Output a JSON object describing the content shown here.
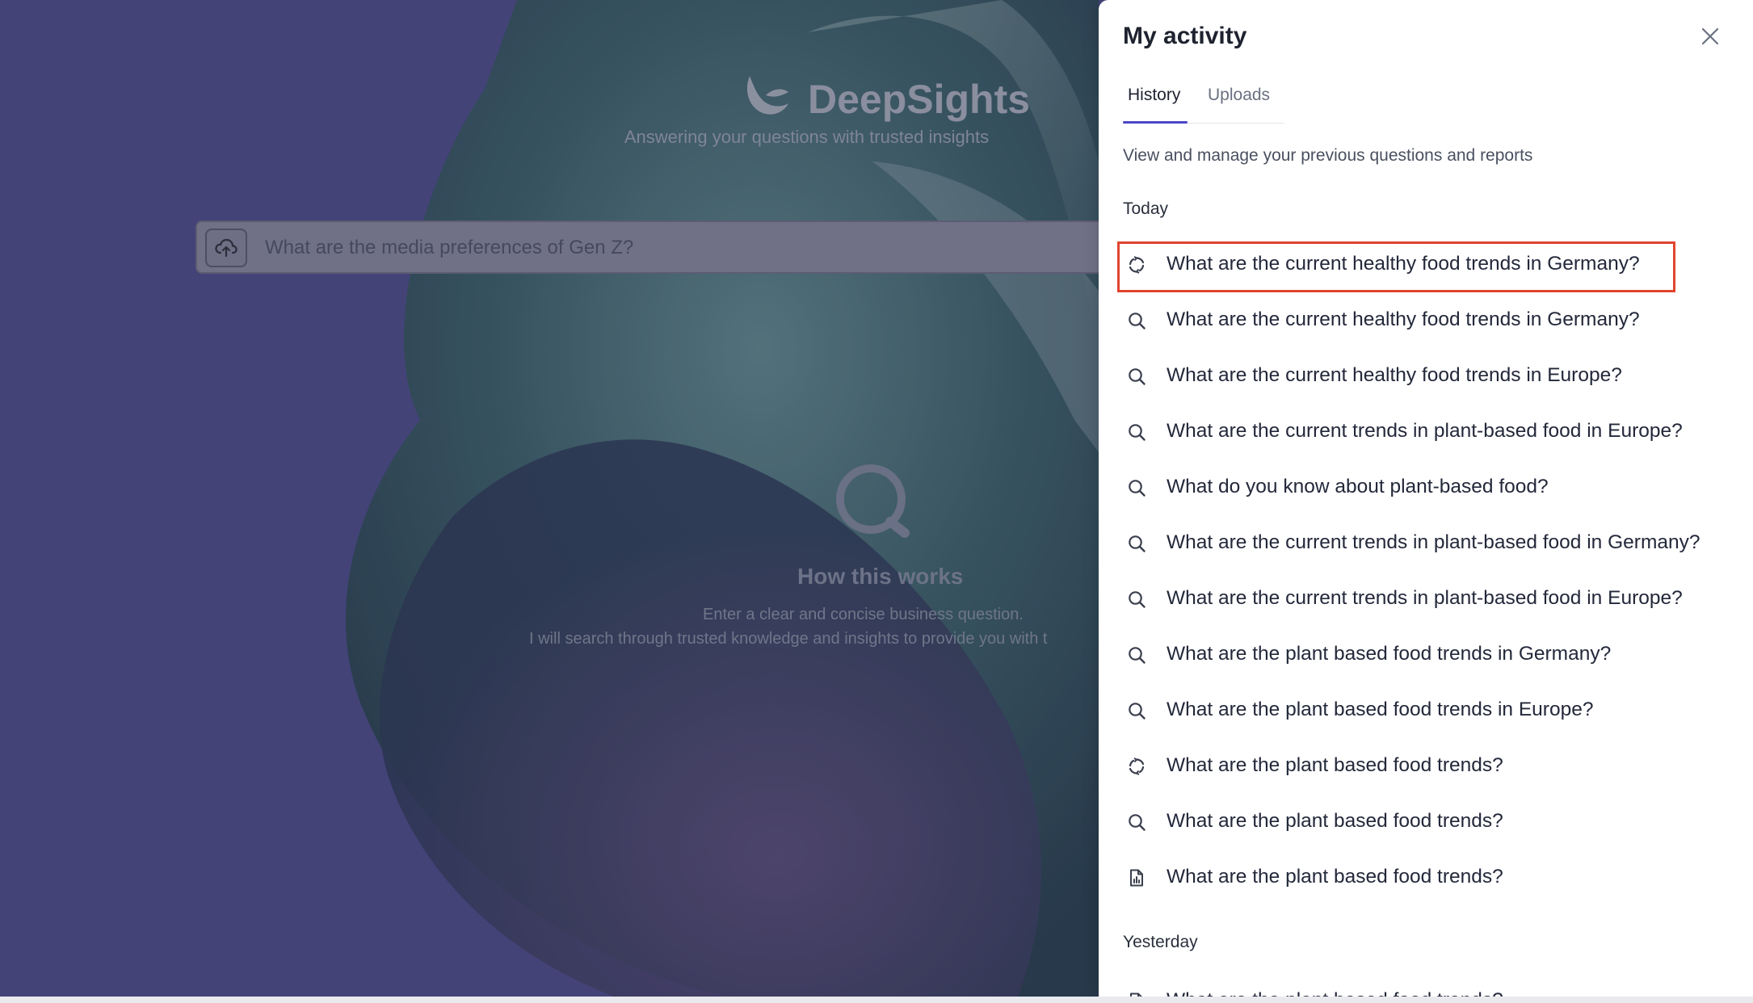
{
  "brand": {
    "name": "DeepSights",
    "tagline": "Answering your questions with trusted insights"
  },
  "search": {
    "placeholder": "What are the media preferences of Gen Z?"
  },
  "how_it_works": {
    "title": "How this works",
    "line1": "Enter a clear and concise business question.",
    "line2": "I will search through trusted knowledge and insights to provide you with t"
  },
  "panel": {
    "title": "My activity",
    "tabs": [
      {
        "label": "History",
        "active": true
      },
      {
        "label": "Uploads",
        "active": false
      }
    ],
    "description": "View and manage your previous questions and reports",
    "sections": [
      {
        "label": "Today",
        "items": [
          {
            "icon": "refresh-icon",
            "text": "What are the current healthy food trends in Germany?",
            "highlighted": true
          },
          {
            "icon": "search-icon",
            "text": "What are the current healthy food trends in Germany?"
          },
          {
            "icon": "search-icon",
            "text": "What are the current healthy food trends in Europe?"
          },
          {
            "icon": "search-icon",
            "text": "What are the current trends in plant-based food in Europe?"
          },
          {
            "icon": "search-icon",
            "text": "What do you know about plant-based food?"
          },
          {
            "icon": "search-icon",
            "text": "What are the current trends in plant-based food in Germany?"
          },
          {
            "icon": "search-icon",
            "text": "What are the current trends in plant-based food in Europe?"
          },
          {
            "icon": "search-icon",
            "text": "What are the plant based food trends in Germany?"
          },
          {
            "icon": "search-icon",
            "text": "What are the plant based food trends in Europe?"
          },
          {
            "icon": "refresh-icon",
            "text": "What are the plant based food trends?"
          },
          {
            "icon": "search-icon",
            "text": "What are the plant based food trends?"
          },
          {
            "icon": "report-icon",
            "text": "What are the plant based food trends?"
          }
        ]
      },
      {
        "label": "Yesterday",
        "items": [
          {
            "icon": "report-icon",
            "text": "What are the plant based food trends?"
          }
        ]
      }
    ]
  },
  "colors": {
    "accent": "#4b47c8",
    "highlight": "#e0442e",
    "background": "#4a4a82"
  }
}
